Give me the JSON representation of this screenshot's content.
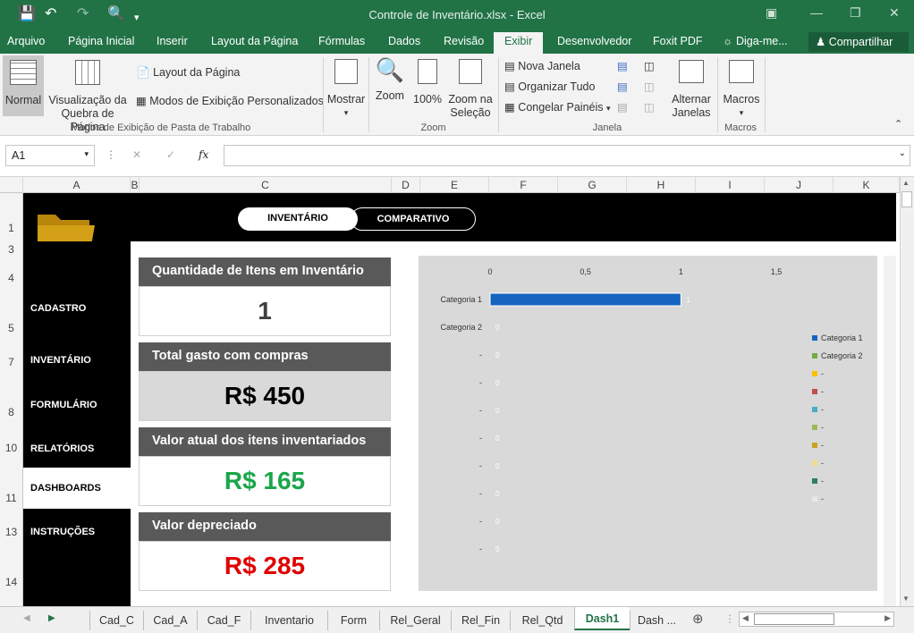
{
  "window": {
    "title": "Controle de Inventário.xlsx - Excel"
  },
  "ribbon_tabs": [
    "Arquivo",
    "Página Inicial",
    "Inserir",
    "Layout da Página",
    "Fórmulas",
    "Dados",
    "Revisão",
    "Exibir",
    "Desenvolvedor",
    "Foxit PDF"
  ],
  "tell_me": "Diga-me...",
  "share_label": "Compartilhar",
  "ribbon": {
    "views": {
      "normal": "Normal",
      "page_break": "Visualização da Quebra de Página",
      "page_layout": "Layout da Página",
      "custom_views": "Modos de Exibição Personalizados",
      "group_label": "Modos de Exibição de Pasta de Trabalho"
    },
    "show": {
      "label": "Mostrar"
    },
    "zoom": {
      "zoom": "Zoom",
      "hundred": "100%",
      "selection": "Zoom na Seleção",
      "group_label": "Zoom"
    },
    "window": {
      "new_window": "Nova Janela",
      "arrange_all": "Organizar Tudo",
      "freeze": "Congelar Painéis",
      "switch": "Alternar Janelas",
      "group_label": "Janela"
    },
    "macros": {
      "label": "Macros",
      "group_label": "Macros"
    }
  },
  "formula_bar": {
    "name_box": "A1",
    "fx": "fx",
    "value": ""
  },
  "columns": [
    "A",
    "B",
    "C",
    "D",
    "E",
    "F",
    "G",
    "H",
    "I",
    "J",
    "K"
  ],
  "rows": [
    "1",
    "3",
    "4",
    "5",
    "7",
    "8",
    "10",
    "11",
    "13",
    "14"
  ],
  "dashboard": {
    "top_buttons": [
      "INVENTÁRIO",
      "COMPARATIVO"
    ],
    "nav": [
      "CADASTRO",
      "INVENTÁRIO",
      "FORMULÁRIO",
      "RELATÓRIOS",
      "DASHBOARDS",
      "INSTRUÇÕES"
    ],
    "active_nav": "DASHBOARDS",
    "cards": [
      {
        "title": "Quantidade de Itens em Inventário",
        "value": "1",
        "color": "#404040"
      },
      {
        "title": "Total gasto com compras",
        "value": "R$ 450",
        "color": "#000000"
      },
      {
        "title": "Valor atual dos itens inventariados",
        "value": "R$ 165",
        "color": "#1aa64a"
      },
      {
        "title": "Valor depreciado",
        "value": "R$ 285",
        "color": "#e00000"
      }
    ]
  },
  "chart_data": {
    "type": "bar",
    "orientation": "horizontal",
    "categories": [
      "Categoria 1",
      "Categoria 2",
      "-",
      "-",
      "-",
      "-",
      "-",
      "-",
      "-",
      "-"
    ],
    "values": [
      1,
      0,
      0,
      0,
      0,
      0,
      0,
      0,
      0,
      0
    ],
    "data_labels": [
      "1",
      "0",
      "0",
      "0",
      "0",
      "0",
      "0",
      "0",
      "0",
      "0"
    ],
    "x_ticks": [
      "0",
      "0,5",
      "1",
      "1,5"
    ],
    "xlim": [
      0,
      1.5
    ],
    "axis_position": "top",
    "legend": {
      "position": "right",
      "entries": [
        {
          "label": "Categoria 1",
          "color": "#1565c0"
        },
        {
          "label": "Categoria 2",
          "color": "#70ad47"
        },
        {
          "label": "-",
          "color": "#ffc000"
        },
        {
          "label": "-",
          "color": "#c0504d"
        },
        {
          "label": "-",
          "color": "#4bacc6"
        },
        {
          "label": "-",
          "color": "#9bbb59"
        },
        {
          "label": "-",
          "color": "#c9a227"
        },
        {
          "label": "-",
          "color": "#f2dc8c"
        },
        {
          "label": "-",
          "color": "#2e7d6b"
        },
        {
          "label": "-",
          "color": "#e8e8e8"
        }
      ]
    },
    "bar_color": "#1565c0"
  },
  "sheet_tabs": [
    "Cad_C",
    "Cad_A",
    "Cad_F",
    "Inventario",
    "Form",
    "Rel_Geral",
    "Rel_Fin",
    "Rel_Qtd",
    "Dash1",
    "Dash ..."
  ],
  "active_sheet": "Dash1"
}
